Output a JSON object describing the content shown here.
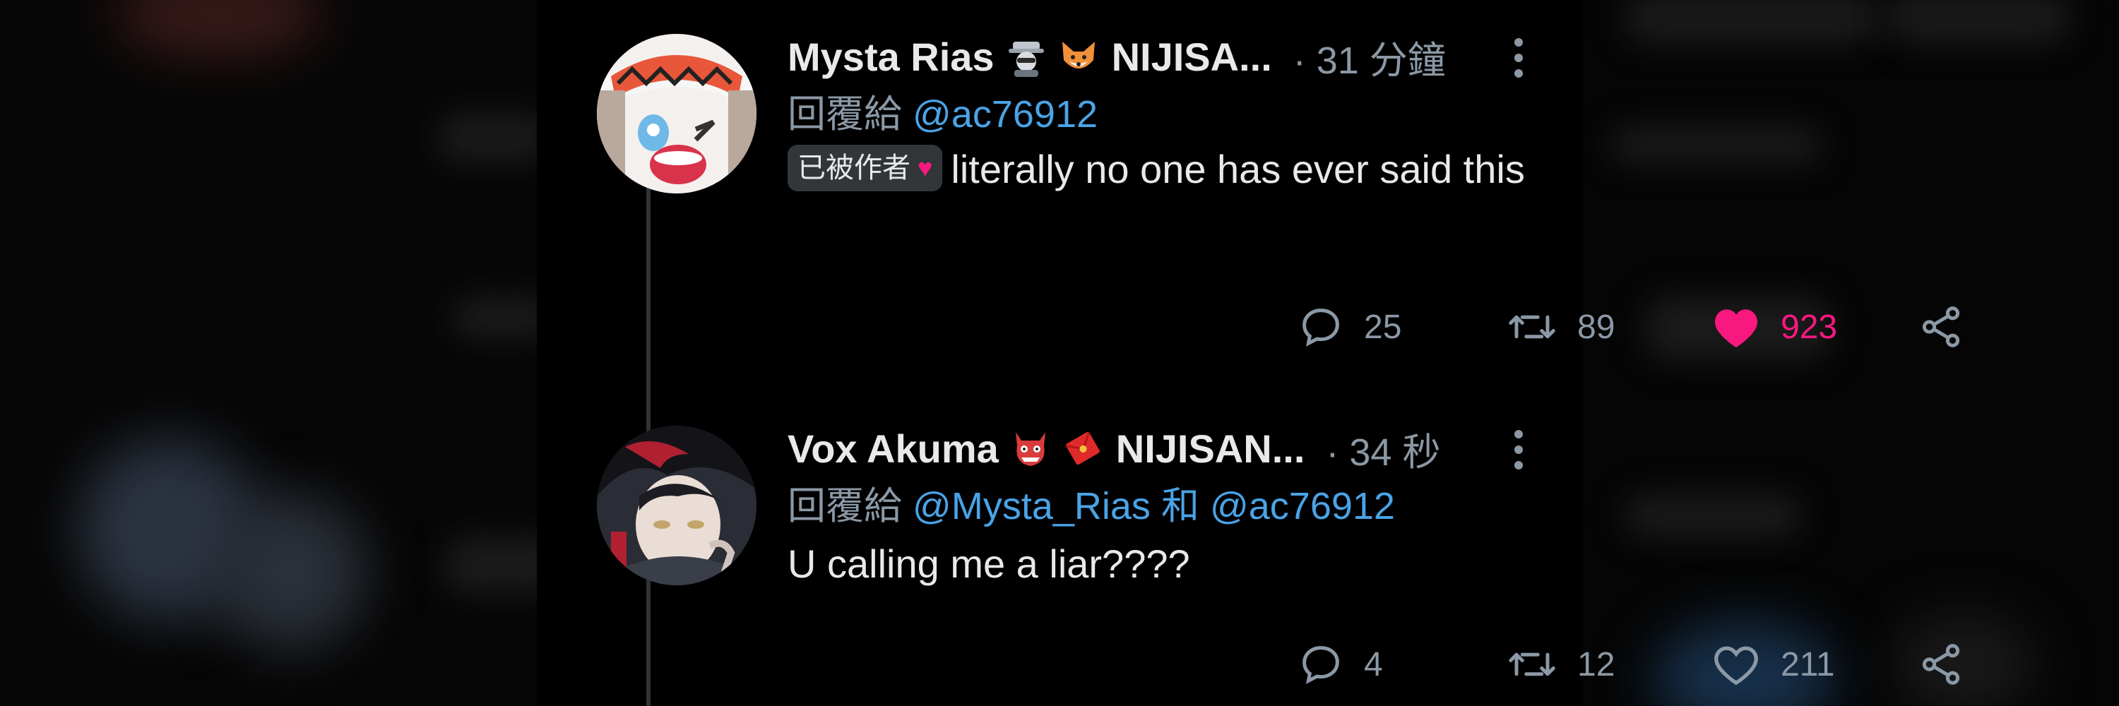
{
  "tweets": [
    {
      "display_name": "Mysta Rias",
      "name_suffix": "NIJISA...",
      "time": "· 31 分鐘",
      "reply_prefix": "回覆給",
      "reply_to": "@ac76912",
      "badge_label": "已被作者",
      "badge_heart": "♥",
      "text": "literally no one has ever said this",
      "replies": "25",
      "retweets": "89",
      "likes": "923",
      "liked": true
    },
    {
      "display_name": "Vox Akuma",
      "name_suffix": "NIJISAN...",
      "time": "· 34 秒",
      "reply_prefix": "回覆給",
      "reply_to_1": "@Mysta_Rias",
      "reply_joiner": "和",
      "reply_to_2": "@ac76912",
      "text": "U calling me a liar????",
      "replies": "4",
      "retweets": "12",
      "likes": "211",
      "liked": false
    }
  ],
  "colors": {
    "accent": "#4aa3e6",
    "like": "#f91880",
    "muted": "#8b98a5",
    "text": "#e7e9ea",
    "background": "#000000"
  },
  "icons": [
    "reply-icon",
    "retweet-icon",
    "heart-icon",
    "share-icon",
    "more-options-icon"
  ]
}
